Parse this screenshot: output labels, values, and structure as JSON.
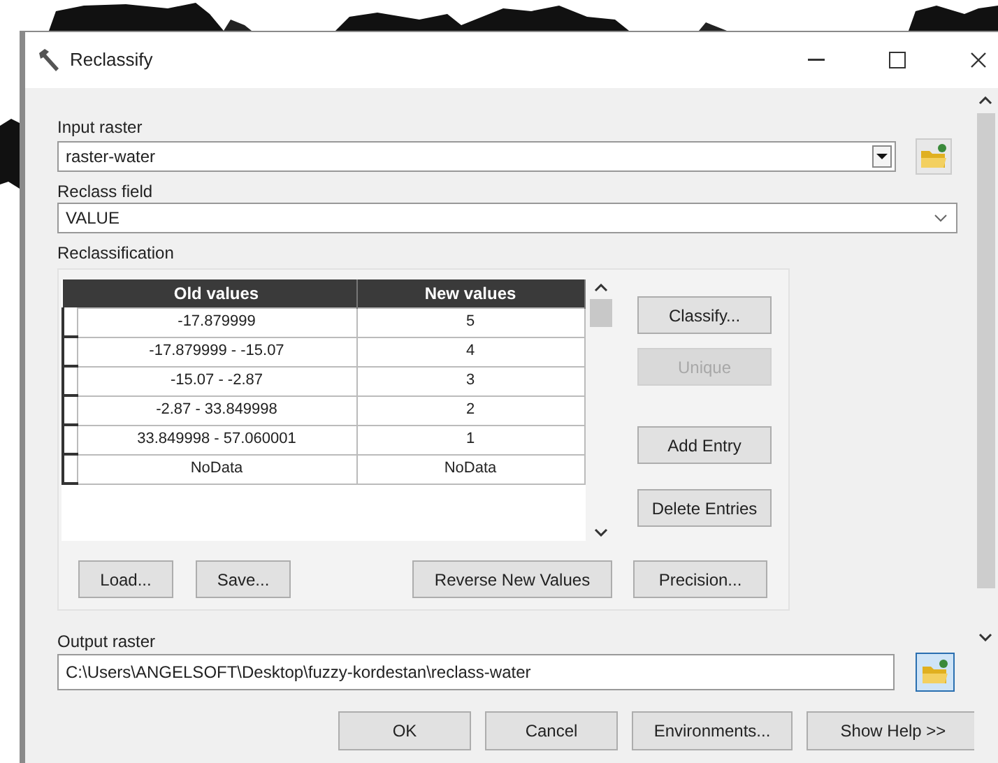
{
  "window": {
    "title": "Reclassify"
  },
  "input_raster": {
    "label": "Input raster",
    "value": "raster-water"
  },
  "reclass_field": {
    "label": "Reclass field",
    "value": "VALUE"
  },
  "reclassification": {
    "label": "Reclassification",
    "table": {
      "columns": [
        "Old values",
        "New values"
      ],
      "rows": [
        {
          "old": "-17.879999",
          "new": "5"
        },
        {
          "old": "-17.879999 - -15.07",
          "new": "4"
        },
        {
          "old": "-15.07 - -2.87",
          "new": "3"
        },
        {
          "old": "-2.87 - 33.849998",
          "new": "2"
        },
        {
          "old": "33.849998 - 57.060001",
          "new": "1"
        },
        {
          "old": "NoData",
          "new": "NoData"
        }
      ]
    },
    "side_buttons": [
      {
        "label": "Classify...",
        "disabled": false
      },
      {
        "label": "Unique",
        "disabled": true
      },
      {
        "label": "Add Entry",
        "disabled": false
      },
      {
        "label": "Delete Entries",
        "disabled": false
      }
    ],
    "bottom_buttons": [
      "Load...",
      "Save...",
      "Reverse New Values",
      "Precision..."
    ]
  },
  "output_raster": {
    "label": "Output raster",
    "value": "C:\\Users\\ANGELSOFT\\Desktop\\fuzzy-kordestan\\reclass-water"
  },
  "dialog_buttons": [
    "OK",
    "Cancel",
    "Environments...",
    "Show Help >>"
  ]
}
